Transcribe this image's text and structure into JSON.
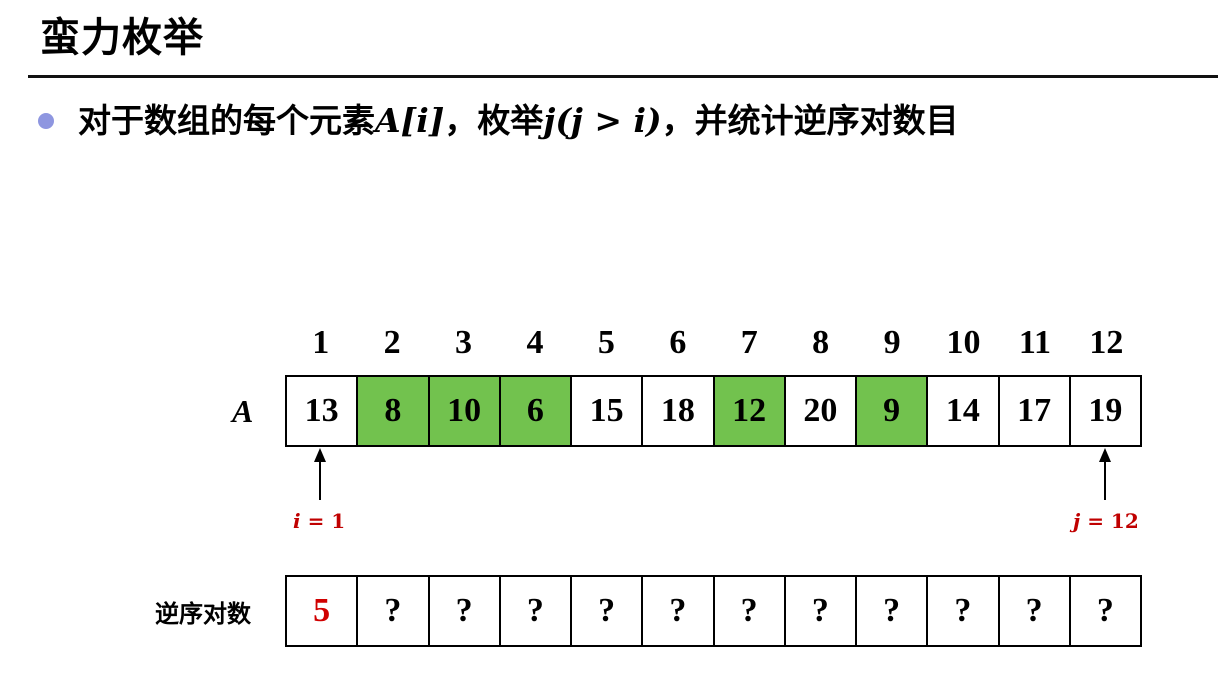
{
  "title": "蛮力枚举",
  "bullet": {
    "prefix": "对于数组的每个元素",
    "a_i": "A[i]",
    "mid": "，枚举",
    "j_expr": "j(j > i)",
    "suffix": "，并统计逆序对数目",
    "dot_color": "#8e96e0"
  },
  "array": {
    "label": "A",
    "indices": [
      "1",
      "2",
      "3",
      "4",
      "5",
      "6",
      "7",
      "8",
      "9",
      "10",
      "11",
      "12"
    ],
    "values": [
      "13",
      "8",
      "10",
      "6",
      "15",
      "18",
      "12",
      "20",
      "9",
      "14",
      "17",
      "19"
    ],
    "highlighted": [
      false,
      true,
      true,
      true,
      false,
      false,
      true,
      false,
      true,
      false,
      false,
      false
    ],
    "highlight_color": "#72c24e"
  },
  "pointers": {
    "i_var": "i",
    "i_rest": " = 1",
    "j_var": "j",
    "j_rest": " = 12",
    "color": "#c00000"
  },
  "inversions": {
    "label": "逆序对数",
    "values": [
      "5",
      "?",
      "?",
      "?",
      "?",
      "?",
      "?",
      "?",
      "?",
      "?",
      "?",
      "?"
    ],
    "first_color": "#d00000"
  }
}
